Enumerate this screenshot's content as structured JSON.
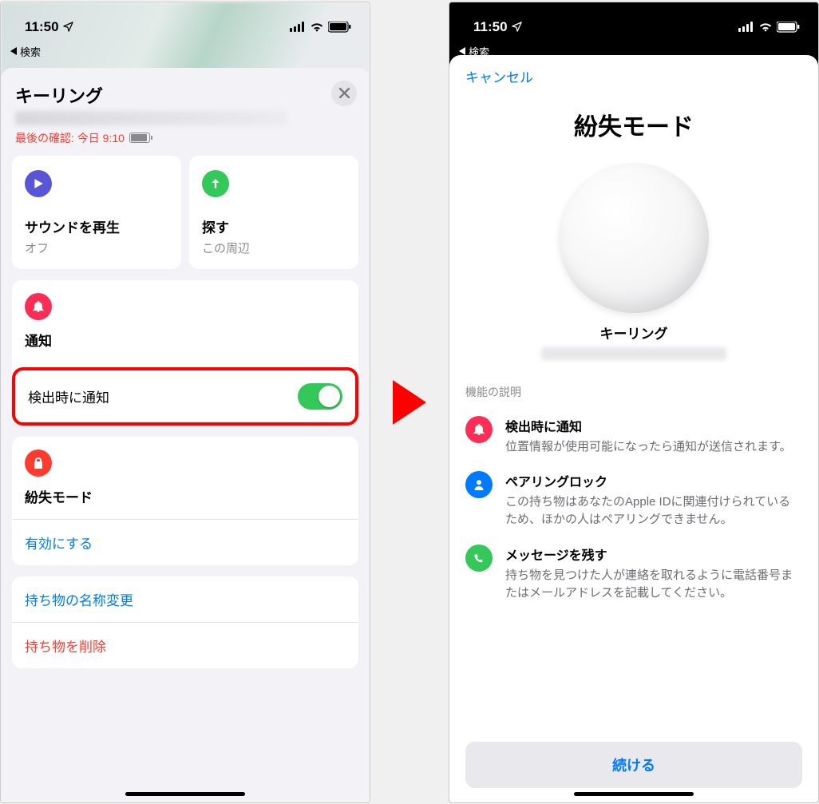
{
  "status": {
    "time": "11:50",
    "breadcrumb": "検索"
  },
  "left": {
    "title": "キーリング",
    "last_seen_prefix": "最後の確認: 今日",
    "last_seen_time": "9:10",
    "actions": {
      "play_sound": {
        "title": "サウンドを再生",
        "sub": "オフ"
      },
      "find": {
        "title": "探す",
        "sub": "この周辺"
      }
    },
    "notify_section": "通知",
    "notify_row": "検出時に通知",
    "lost_section": "紛失モード",
    "enable_link": "有効にする",
    "rename_link": "持ち物の名称変更",
    "delete_link": "持ち物を削除"
  },
  "right": {
    "cancel": "キャンセル",
    "title": "紛失モード",
    "device_name": "キーリング",
    "desc_head": "機能の説明",
    "f1": {
      "t": "検出時に通知",
      "d": "位置情報が使用可能になったら通知が送信されます。"
    },
    "f2": {
      "t": "ペアリングロック",
      "d": "この持ち物はあなたのApple IDに関連付けられているため、ほかの人はペアリングできません。"
    },
    "f3": {
      "t": "メッセージを残す",
      "d": "持ち物を見つけた人が連絡を取れるように電話番号またはメールアドレスを記載してください。"
    },
    "continue": "続ける"
  }
}
